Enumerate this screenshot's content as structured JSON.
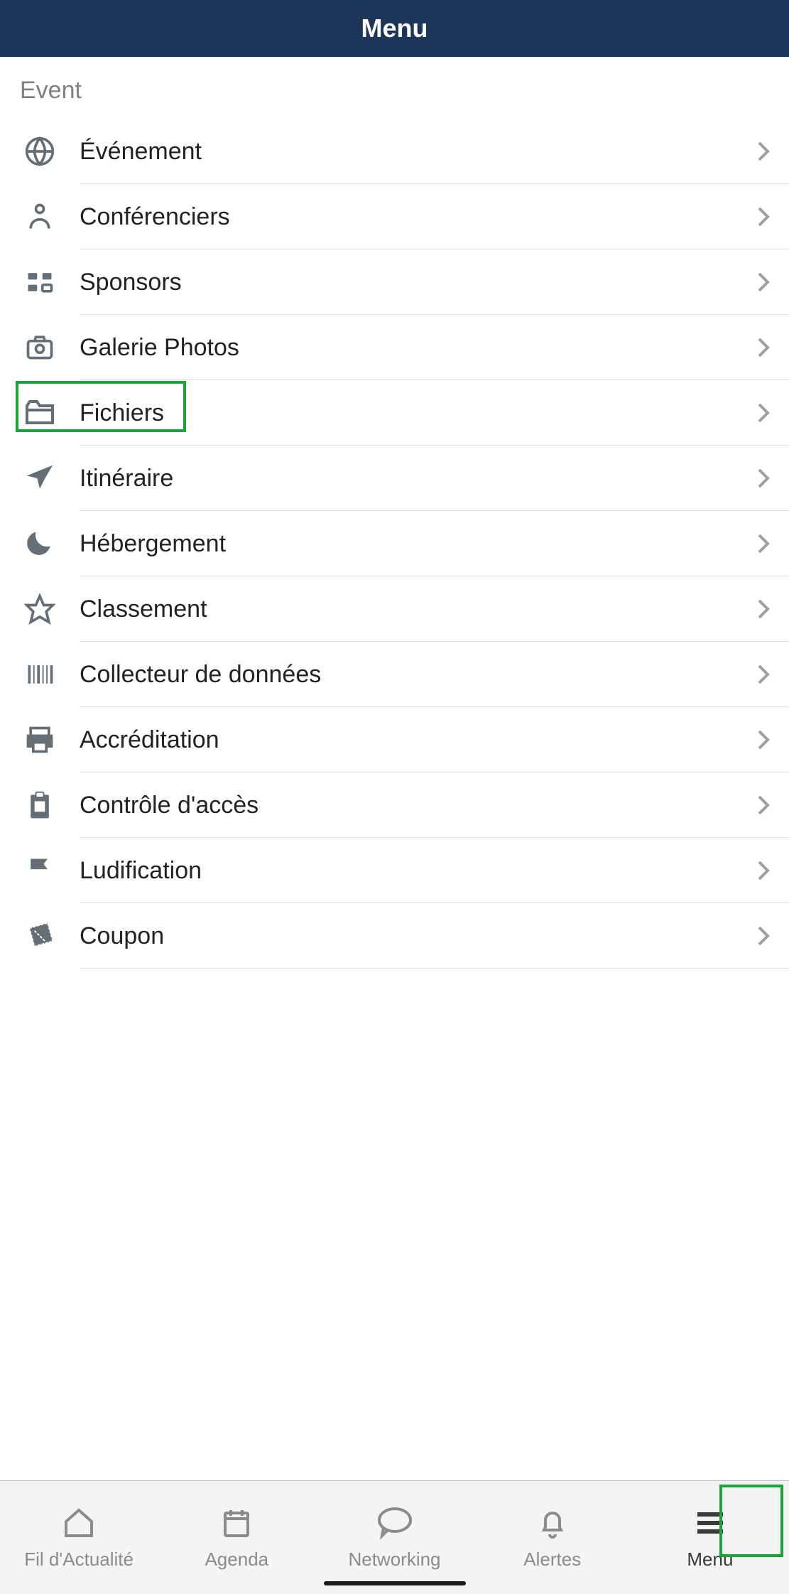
{
  "header": {
    "title": "Menu"
  },
  "section_label": "Event",
  "menu": [
    {
      "label": "Événement",
      "icon": "globe"
    },
    {
      "label": "Conférenciers",
      "icon": "person"
    },
    {
      "label": "Sponsors",
      "icon": "grid"
    },
    {
      "label": "Galerie Photos",
      "icon": "camera"
    },
    {
      "label": "Fichiers",
      "icon": "folder"
    },
    {
      "label": "Itinéraire",
      "icon": "plane"
    },
    {
      "label": "Hébergement",
      "icon": "moon"
    },
    {
      "label": "Classement",
      "icon": "star"
    },
    {
      "label": "Collecteur de données",
      "icon": "barcode"
    },
    {
      "label": "Accréditation",
      "icon": "printer"
    },
    {
      "label": "Contrôle d'accès",
      "icon": "clipboard"
    },
    {
      "label": "Ludification",
      "icon": "flag"
    },
    {
      "label": "Coupon",
      "icon": "ticket"
    }
  ],
  "highlighted_menu_index": 4,
  "tabbar": [
    {
      "label": "Fil d'Actualité",
      "icon": "home"
    },
    {
      "label": "Agenda",
      "icon": "calendar"
    },
    {
      "label": "Networking",
      "icon": "chat"
    },
    {
      "label": "Alertes",
      "icon": "bell"
    },
    {
      "label": "Menu",
      "icon": "menu",
      "active": true
    }
  ],
  "highlighted_tab_index": 4
}
